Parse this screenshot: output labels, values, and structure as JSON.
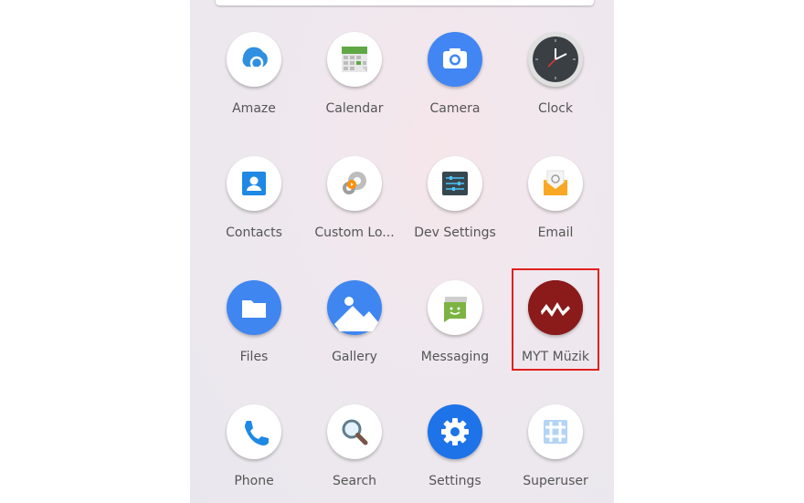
{
  "apps": [
    {
      "label": "Amaze",
      "icon": "amaze-icon"
    },
    {
      "label": "Calendar",
      "icon": "calendar-icon"
    },
    {
      "label": "Camera",
      "icon": "camera-icon"
    },
    {
      "label": "Clock",
      "icon": "clock-icon"
    },
    {
      "label": "Contacts",
      "icon": "contacts-icon"
    },
    {
      "label": "Custom Lo...",
      "icon": "custom-locale-icon"
    },
    {
      "label": "Dev Settings",
      "icon": "dev-settings-icon"
    },
    {
      "label": "Email",
      "icon": "email-icon"
    },
    {
      "label": "Files",
      "icon": "folder-icon"
    },
    {
      "label": "Gallery",
      "icon": "gallery-icon"
    },
    {
      "label": "Messaging",
      "icon": "messaging-icon"
    },
    {
      "label": "MYT Müzik",
      "icon": "myt-muzik-icon"
    },
    {
      "label": "Phone",
      "icon": "phone-icon"
    },
    {
      "label": "Search",
      "icon": "search-icon"
    },
    {
      "label": "Settings",
      "icon": "gear-icon"
    },
    {
      "label": "Superuser",
      "icon": "superuser-icon"
    }
  ],
  "highlighted_app": "MYT Müzik",
  "colors": {
    "highlight": "#e02020",
    "label": "#555555"
  }
}
